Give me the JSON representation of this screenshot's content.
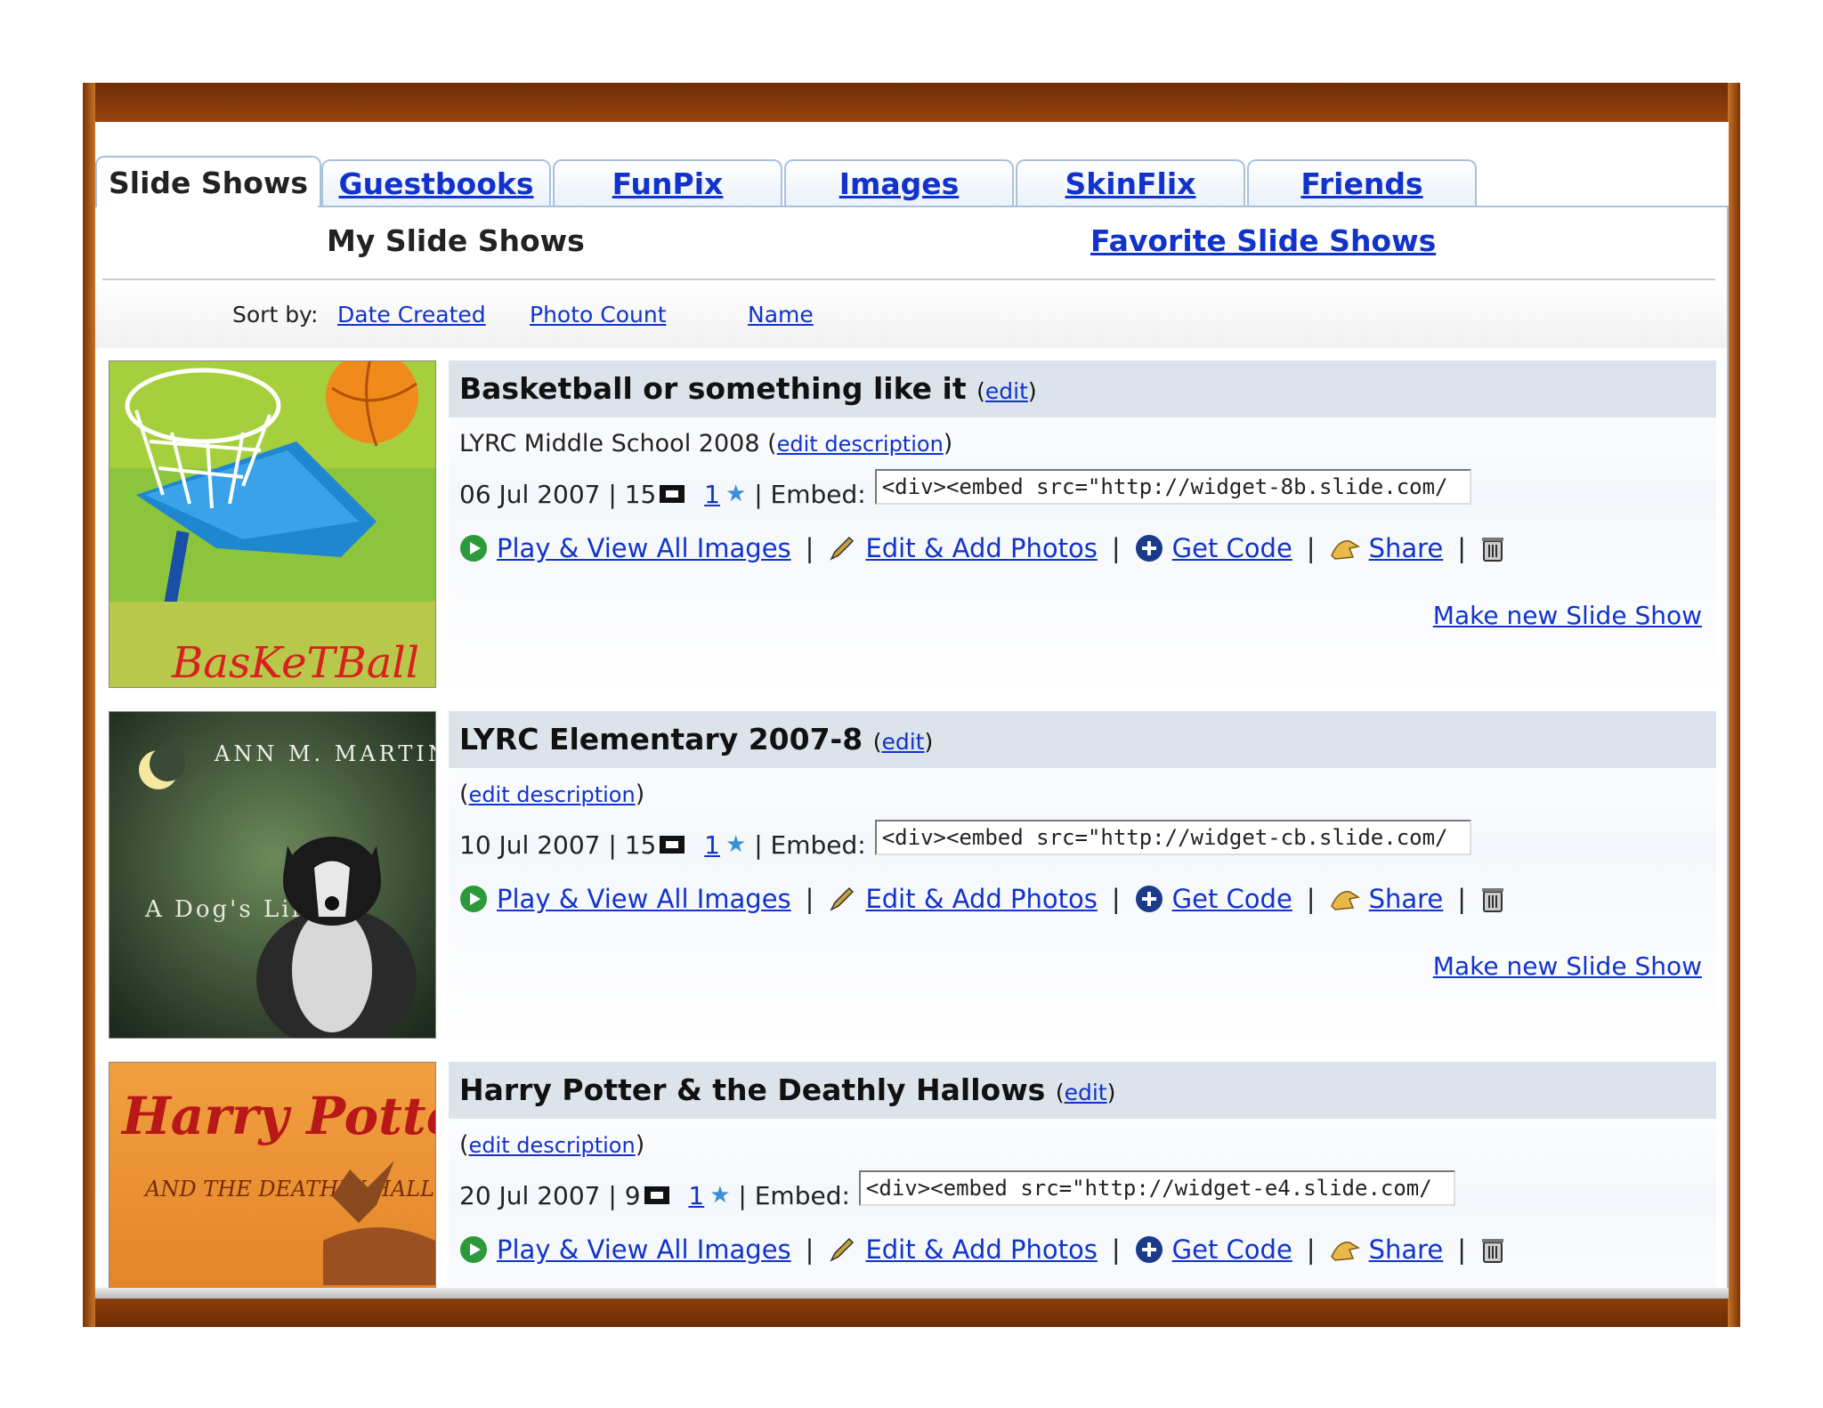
{
  "tabs": {
    "active": "Slide Shows",
    "others": [
      "Guestbooks",
      "FunPix",
      "Images",
      "SkinFlix",
      "Friends"
    ]
  },
  "subtabs": {
    "my": "My Slide Shows",
    "favorite": "Favorite Slide Shows"
  },
  "sort": {
    "label": "Sort by:",
    "options": [
      "Date Created",
      "Photo Count",
      "Name"
    ]
  },
  "labels": {
    "edit": "edit",
    "edit_description": "edit description",
    "embed": "Embed:",
    "play": "Play & View All Images",
    "edit_add": "Edit & Add Photos",
    "get_code": "Get Code",
    "share": "Share",
    "make_new": "Make new Slide Show"
  },
  "slideshows": [
    {
      "title": "Basketball or something like it",
      "description": "LYRC Middle School 2008",
      "date": "06 Jul 2007",
      "photo_count": "15",
      "rating": "1",
      "embed": "<div><embed src=\"http://widget-8b.slide.com/",
      "thumb_text": "BasKeTBall"
    },
    {
      "title": "LYRC Elementary 2007-8",
      "description": "",
      "date": "10 Jul 2007",
      "photo_count": "15",
      "rating": "1",
      "embed": "<div><embed src=\"http://widget-cb.slide.com/",
      "thumb_text": "ANN M. MARTIN",
      "thumb_subtext": "A Dog's Life"
    },
    {
      "title": "Harry Potter & the Deathly Hallows",
      "description": "",
      "date": "20 Jul 2007",
      "photo_count": "9",
      "rating": "1",
      "embed": "<div><embed src=\"http://widget-e4.slide.com/",
      "thumb_text": "Harry Potter",
      "thumb_subtext": "AND THE DEATHLY HALLOWS"
    }
  ],
  "colors": {
    "link": "#1133cc",
    "frame": "#a24a12",
    "header_band": "#dde3ea",
    "tab_border": "#a9c1dd"
  },
  "icons": [
    "play-icon",
    "pencil-icon",
    "plus-circle-icon",
    "share-hand-icon",
    "trash-icon",
    "photos-icon",
    "star-icon"
  ]
}
